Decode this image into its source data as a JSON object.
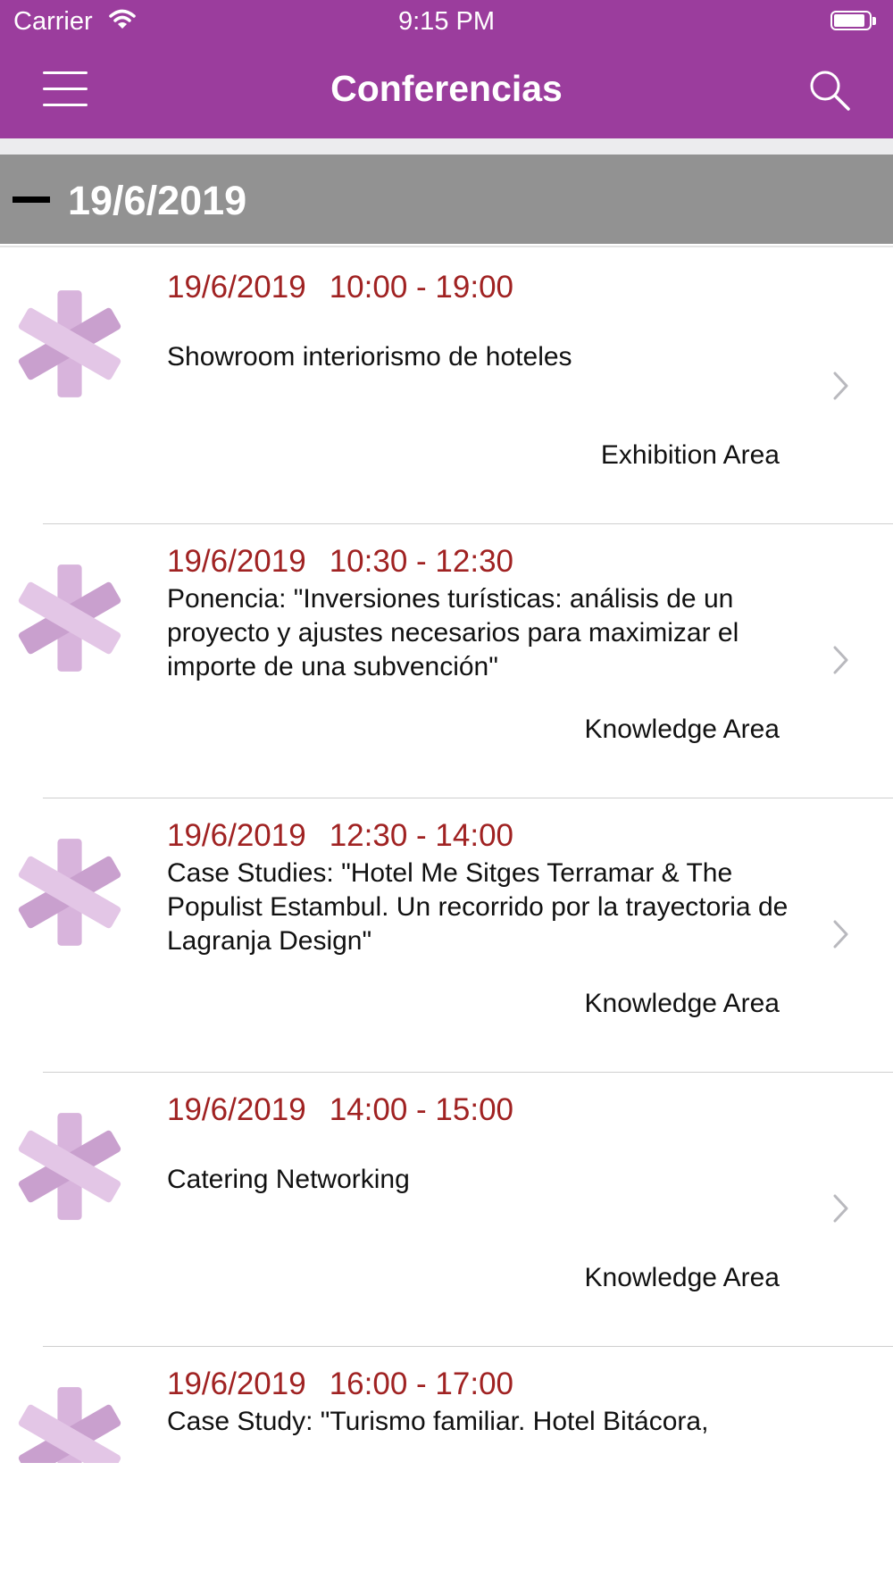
{
  "status_bar": {
    "carrier": "Carrier",
    "time": "9:15 PM"
  },
  "nav": {
    "title": "Conferencias",
    "menu_icon": "hamburger-menu-icon",
    "search_icon": "search-icon"
  },
  "colors": {
    "brand": "#9b3d9d",
    "section_header": "#929292",
    "datetime": "#a02222",
    "thumbnail": "#d8b4dc"
  },
  "section": {
    "date": "19/6/2019",
    "icon": "collapse-minus-icon"
  },
  "events": [
    {
      "date": "19/6/2019",
      "time": "10:00 - 19:00",
      "title": "Showroom interiorismo de hoteles",
      "area": "Exhibition Area"
    },
    {
      "date": "19/6/2019",
      "time": "10:30 - 12:30",
      "title": "Ponencia: \"Inversiones turísticas: análisis de un proyecto y ajustes necesarios para maximizar el importe de una subvención\"",
      "area": "Knowledge Area"
    },
    {
      "date": "19/6/2019",
      "time": "12:30 - 14:00",
      "title": "Case Studies: \"Hotel Me Sitges Terramar & The Populist Estambul. Un recorrido por la trayectoria de Lagranja Design\"",
      "area": "Knowledge Area"
    },
    {
      "date": "19/6/2019",
      "time": "14:00 - 15:00",
      "title": "Catering Networking",
      "area": "Knowledge Area"
    },
    {
      "date": "19/6/2019",
      "time": "16:00 - 17:00",
      "title": "Case Study: \"Turismo familiar. Hotel Bitácora,",
      "area": ""
    }
  ]
}
